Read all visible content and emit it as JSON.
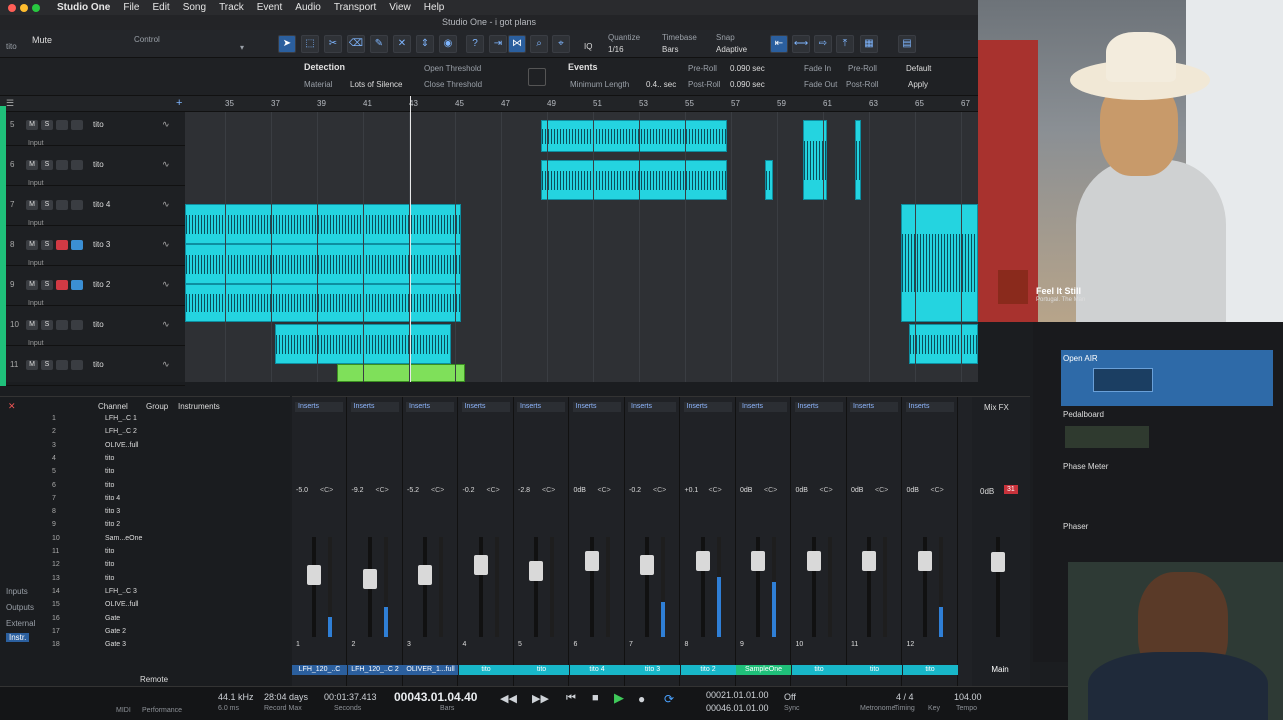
{
  "menubar": {
    "app": "Studio One",
    "items": [
      "File",
      "Edit",
      "Song",
      "Track",
      "Event",
      "Audio",
      "Transport",
      "View",
      "Help"
    ]
  },
  "window": {
    "title": "Studio One - i got plans"
  },
  "toolbar": {
    "track_name": "tito",
    "mute_label": "Mute",
    "control_label": "Control",
    "quantize_label": "Quantize",
    "quantize_value": "1/16",
    "timebase_label": "Timebase",
    "timebase_value": "Bars",
    "snap_label": "Snap",
    "snap_value": "Adaptive"
  },
  "detection": {
    "detection": "Detection",
    "material": "Material",
    "material_value": "Lots of Silence",
    "open_threshold": "Open Threshold",
    "close_threshold": "Close Threshold",
    "events": "Events",
    "minimum_length": "Minimum Length",
    "min_len_value": "0.4.. sec",
    "pre_roll": "Pre-Roll",
    "pre_roll_value": "0.090 sec",
    "post_roll": "Post-Roll",
    "post_roll_value": "0.090 sec",
    "fade_in": "Fade In",
    "fade_out": "Fade Out",
    "pre_roll_2": "Pre-Roll",
    "post_roll_2": "Post-Roll",
    "default": "Default",
    "apply": "Apply"
  },
  "ruler": [
    "35",
    "37",
    "39",
    "41",
    "43",
    "45",
    "47",
    "49",
    "51",
    "53",
    "55",
    "57",
    "59",
    "61",
    "63",
    "65",
    "67"
  ],
  "tracks": [
    {
      "num": "5",
      "name": "tito",
      "input": "Input",
      "rec": false
    },
    {
      "num": "6",
      "name": "tito",
      "input": "Input",
      "rec": false
    },
    {
      "num": "7",
      "name": "tito 4",
      "input": "Input",
      "rec": false
    },
    {
      "num": "8",
      "name": "tito 3",
      "input": "Input",
      "rec": true
    },
    {
      "num": "9",
      "name": "tito 2",
      "input": "Input",
      "rec": true
    },
    {
      "num": "10",
      "name": "tito",
      "input": "Input",
      "rec": false
    },
    {
      "num": "11",
      "name": "tito",
      "input": "",
      "rec": false
    }
  ],
  "mixer_left": {
    "tabs": [
      "Channel",
      "Group",
      "Instruments"
    ],
    "channels": [
      "LFH_..C 1",
      "LFH_..C 2",
      "OLIVE..full",
      "tito",
      "tito",
      "tito",
      "tito 4",
      "tito 3",
      "tito 2",
      "Sam...eOne",
      "tito",
      "tito",
      "tito",
      "LFH_..C 3",
      "OLIVE..full",
      "Gate",
      "Gate 2",
      "Gate 3"
    ],
    "side": [
      "Inputs",
      "Outputs",
      "External",
      "Instr."
    ],
    "remote": "Remote"
  },
  "strips": [
    {
      "insert": "Inserts",
      "vol": "-5.0",
      "pan": "<C>",
      "num": "1",
      "name": "LFH_120_..C",
      "level": 0.2,
      "cap": 0.28
    },
    {
      "insert": "Inserts",
      "vol": "-9.2",
      "pan": "<C>",
      "num": "2",
      "name": "LFH_120_..C 2",
      "level": 0.3,
      "cap": 0.32
    },
    {
      "insert": "Inserts",
      "vol": "-5.2",
      "pan": "<C>",
      "num": "3",
      "name": "OLIVER_1...full",
      "level": 0.0,
      "cap": 0.28
    },
    {
      "insert": "Inserts",
      "vol": "-0.2",
      "pan": "<C>",
      "num": "4",
      "name": "tito",
      "level": 0.0,
      "cap": 0.18
    },
    {
      "insert": "Inserts",
      "vol": "-2.8",
      "pan": "<C>",
      "num": "5",
      "name": "tito",
      "level": 0.0,
      "cap": 0.24
    },
    {
      "insert": "Inserts",
      "vol": "0dB",
      "pan": "<C>",
      "num": "6",
      "name": "tito 4",
      "level": 0.0,
      "cap": 0.14
    },
    {
      "insert": "Inserts",
      "vol": "-0.2",
      "pan": "<C>",
      "num": "7",
      "name": "tito 3",
      "level": 0.35,
      "cap": 0.18
    },
    {
      "insert": "Inserts",
      "vol": "+0.1",
      "pan": "<C>",
      "num": "8",
      "name": "tito 2",
      "level": 0.6,
      "cap": 0.14
    },
    {
      "insert": "Inserts",
      "vol": "0dB",
      "pan": "<C>",
      "num": "9",
      "name": "SampleOne",
      "level": 0.55,
      "cap": 0.14
    },
    {
      "insert": "Inserts",
      "vol": "0dB",
      "pan": "<C>",
      "num": "10",
      "name": "tito",
      "level": 0.0,
      "cap": 0.14
    },
    {
      "insert": "Inserts",
      "vol": "0dB",
      "pan": "<C>",
      "num": "11",
      "name": "tito",
      "level": 0.0,
      "cap": 0.14
    },
    {
      "insert": "Inserts",
      "vol": "0dB",
      "pan": "<C>",
      "num": "12",
      "name": "tito",
      "level": 0.3,
      "cap": 0.14
    }
  ],
  "main": {
    "label": "Mix FX",
    "vol": "0dB",
    "peak": "31",
    "name": "Main"
  },
  "fxpanel": [
    "Open AIR",
    "Pedalboard",
    "Phase Meter",
    "Phaser"
  ],
  "nowplaying": {
    "title": "Feel It Still",
    "artist": "Portugal. The Man"
  },
  "transport": {
    "rate": "44.1 kHz",
    "latency": "6.0 ms",
    "days": "28:04 days",
    "record_max": "Record Max",
    "time": "00:01:37.413",
    "seconds": "Seconds",
    "bars": "00043.01.04.40",
    "bars_label": "Bars",
    "loop_start": "00021.01.01.00",
    "loop_end": "00046.01.01.00",
    "off": "Off",
    "sync": "Sync",
    "sig": "4 / 4",
    "timing": "Timing",
    "key": "Key",
    "tempo": "104.00",
    "tempo_label": "Tempo",
    "metronome": "Metronome",
    "midi": "MIDI",
    "performance": "Performance"
  },
  "colors": {
    "clip": "#24d4e0",
    "rec": "#d13a44",
    "accent": "#2b5f9e",
    "track": "#1fc07a"
  }
}
